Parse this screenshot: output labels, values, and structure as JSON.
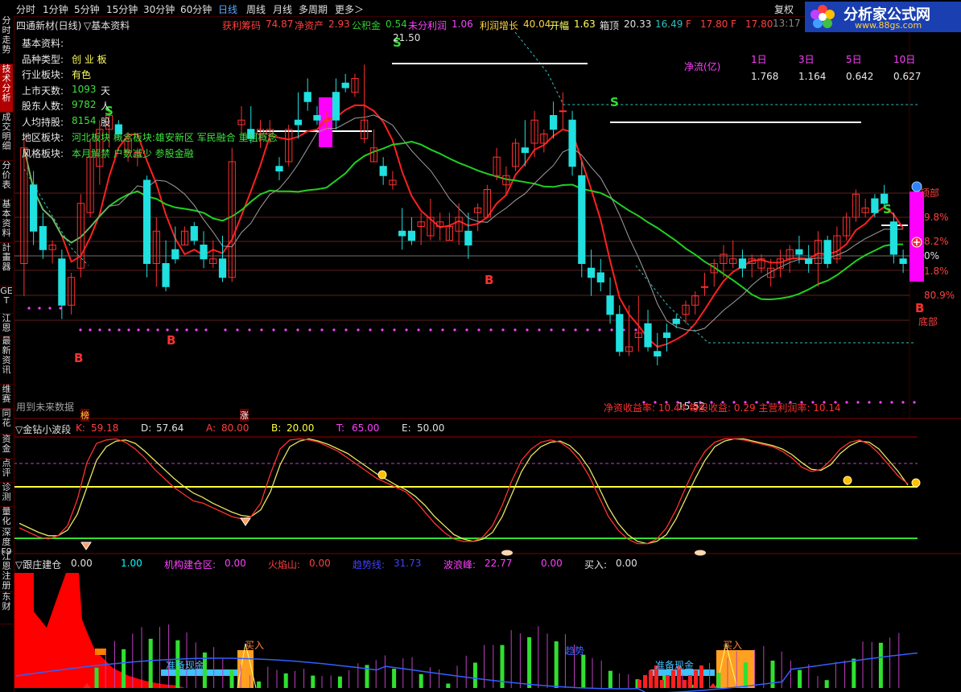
{
  "toolbar": {
    "timeframes": [
      "分时",
      "1分钟",
      "5分钟",
      "15分钟",
      "30分钟",
      "60分钟",
      "日线",
      "周线",
      "月线",
      "多周期",
      "更多＞"
    ],
    "active_index": 6,
    "fuquan": "复权",
    "time_fragment": "13:17"
  },
  "logo": {
    "title": "分析家公式网",
    "url": "www.88gs.com"
  },
  "sidebar": {
    "tabs": [
      "分时走势",
      "技术分析",
      "成交明细",
      "分价表",
      "基本资料",
      "計畫器",
      "GET",
      "江恩",
      "最新资讯",
      "维赛",
      "同花",
      "资金",
      "点评",
      "诊测",
      "量化",
      "深度F9",
      "江恩注册",
      "东财"
    ],
    "active_index": 1
  },
  "main_panel": {
    "title": "四通新材(日线)",
    "subtitle": "▽基本资料",
    "metrics": [
      {
        "label": "获利筹码",
        "value": "74.87"
      },
      {
        "label": "净资产",
        "value": "2.93"
      },
      {
        "label": "公积金",
        "value": "0.54"
      },
      {
        "label": "未分利润",
        "value": "1.06"
      },
      {
        "label": "利润增长",
        "value": "40.04"
      },
      {
        "label": "开幅",
        "value": "1.63"
      },
      {
        "label": "箱顶",
        "value": "20.33"
      },
      {
        "label": "",
        "value": "16.49"
      },
      {
        "label": "F",
        "value": "17.80"
      },
      {
        "label": "F",
        "value": "17.80"
      }
    ],
    "info_lines": [
      {
        "label": "基本资料:",
        "value": ""
      },
      {
        "label": "品种类型:",
        "value": "创 业 板"
      },
      {
        "label": "行业板块:",
        "value": "有色"
      },
      {
        "label": "上市天数:",
        "value": "1093",
        "unit": "天"
      },
      {
        "label": "股东人数:",
        "value": "9782",
        "unit": "人"
      },
      {
        "label": "人均持股:",
        "value": "8154",
        "unit": "股"
      },
      {
        "label": "地区板块:",
        "value": "河北板块 概念板块:雄安新区 军民融合 重组概念"
      },
      {
        "label": "风格板块:",
        "value": "本月解禁 户数减少 参股金融"
      }
    ],
    "net_flow": {
      "label": "净流(亿)",
      "headers": [
        "1日",
        "3日",
        "5日",
        "10日"
      ],
      "values": [
        "1.768",
        "1.164",
        "0.642",
        "0.627"
      ]
    },
    "price_high_label": "21.50",
    "price_low_label": "15.52",
    "footer_stats": "净资收益率: 10.44  每股收益: 0.29  主营利润率: 10.14",
    "future_data_note": "用到未来数据",
    "right_labels": [
      "顶部",
      "9.8%",
      "8.2%",
      "0%",
      "1.8%",
      "80.9%",
      "底部"
    ],
    "tags": [
      "榜",
      "涨"
    ],
    "signal_S": "S",
    "signal_B": "B"
  },
  "kd_panel": {
    "title": "▽金钻小波段",
    "items": [
      {
        "label": "K:",
        "value": "59.18",
        "color": "#ff4040"
      },
      {
        "label": "D:",
        "value": "57.64",
        "color": "#e0e0e0"
      },
      {
        "label": "A:",
        "value": "80.00",
        "color": "#ff4040"
      },
      {
        "label": "B:",
        "value": "20.00",
        "color": "#ffff40"
      },
      {
        "label": "T:",
        "value": "65.00",
        "color": "#ff40ff"
      },
      {
        "label": "E:",
        "value": "50.00",
        "color": "#e0e0e0"
      }
    ]
  },
  "vol_panel": {
    "title": "▽跟庄建仓",
    "items": [
      {
        "label": "",
        "value": "0.00",
        "color": "#e0e0e0"
      },
      {
        "label": "",
        "value": "1.00",
        "color": "#00ffff"
      },
      {
        "label": "机构建仓区:",
        "value": "0.00",
        "color": "#ff40ff"
      },
      {
        "label": "火焰山:",
        "value": "0.00",
        "color": "#ff4040"
      },
      {
        "label": "趋势线:",
        "value": "31.73",
        "color": "#4040ff"
      },
      {
        "label": "波浪峰:",
        "value": "22.77",
        "color": "#ff40ff"
      },
      {
        "label": "",
        "value": "0.00",
        "color": "#ff40ff"
      },
      {
        "label": "买入:",
        "value": "0.00",
        "color": "#e0e0e0"
      }
    ],
    "zone_labels": [
      "准备现金",
      "准备现金"
    ],
    "buy_labels": [
      "买入",
      "买入"
    ],
    "trend_label": "趋势"
  },
  "chart_data": [
    {
      "type": "candlestick",
      "title": "四通新材(日线)",
      "y_estimated_range": [
        14.5,
        22.5
      ],
      "candles": [
        [
          17.5,
          20.2,
          16.8,
          20.0
        ],
        [
          19.2,
          19.5,
          17.9,
          18.2
        ],
        [
          18.3,
          18.6,
          17.6,
          17.8
        ],
        [
          17.8,
          18.0,
          17.5,
          17.9
        ],
        [
          17.6,
          17.8,
          16.3,
          16.6
        ],
        [
          16.6,
          17.3,
          16.4,
          17.2
        ],
        [
          17.4,
          19.0,
          17.2,
          18.8
        ],
        [
          18.6,
          20.2,
          18.5,
          19.8
        ],
        [
          19.6,
          20.6,
          19.2,
          20.4
        ],
        [
          20.4,
          20.8,
          20.0,
          20.7
        ],
        [
          20.5,
          20.6,
          20.2,
          20.3
        ],
        [
          19.9,
          20.3,
          19.7,
          20.2
        ],
        [
          19.8,
          20.0,
          19.6,
          19.9
        ],
        [
          19.3,
          19.4,
          17.2,
          17.5
        ],
        [
          17.5,
          18.5,
          17.0,
          18.2
        ],
        [
          17.5,
          18.0,
          16.9,
          17.0
        ],
        [
          17.8,
          18.3,
          17.5,
          17.6
        ],
        [
          17.9,
          18.3,
          17.9,
          18.2
        ],
        [
          18.3,
          18.4,
          17.9,
          18.0
        ],
        [
          17.9,
          18.2,
          17.4,
          17.6
        ],
        [
          17.5,
          18.0,
          17.4,
          17.6
        ],
        [
          17.6,
          18.1,
          17.1,
          17.2
        ],
        [
          17.2,
          20.0,
          17.1,
          19.7
        ],
        [
          20.5,
          20.9,
          20.3,
          20.6
        ],
        [
          20.4,
          20.9,
          20.1,
          20.2
        ],
        [
          20.3,
          20.6,
          20.0,
          20.4
        ],
        [
          20.3,
          20.6,
          20.1,
          20.4
        ],
        [
          19.6,
          19.8,
          19.3,
          19.5
        ],
        [
          19.7,
          20.5,
          19.6,
          20.4
        ],
        [
          20.6,
          21.2,
          20.2,
          20.5
        ],
        [
          21.2,
          21.5,
          20.8,
          21.0
        ],
        [
          20.7,
          20.9,
          20.5,
          20.6
        ],
        [
          20.6,
          20.8,
          20.4,
          20.6
        ],
        [
          21.2,
          21.5,
          20.4,
          20.6
        ],
        [
          21.4,
          21.6,
          21.2,
          21.3
        ],
        [
          21.2,
          21.6,
          21.1,
          21.5
        ],
        [
          20.2,
          21.8,
          20.1,
          20.6
        ],
        [
          19.7,
          20.4,
          19.7,
          20.0
        ],
        [
          19.6,
          19.8,
          19.2,
          19.4
        ],
        [
          19.2,
          19.5,
          19.1,
          19.3
        ],
        [
          18.2,
          18.7,
          17.8,
          18.1
        ],
        [
          18.2,
          18.5,
          17.9,
          18.0
        ],
        [
          18.3,
          18.6,
          17.9,
          18.4
        ],
        [
          18.1,
          18.9,
          18.0,
          18.5
        ],
        [
          18.3,
          18.6,
          18.0,
          18.4
        ],
        [
          18.0,
          18.6,
          18.0,
          18.3
        ],
        [
          18.2,
          18.8,
          17.9,
          18.5
        ],
        [
          18.2,
          18.6,
          17.6,
          17.9
        ],
        [
          18.6,
          18.8,
          18.2,
          18.7
        ],
        [
          18.5,
          19.2,
          18.5,
          19.1
        ],
        [
          19.4,
          20.0,
          19.3,
          19.8
        ],
        [
          19.2,
          19.6,
          19.0,
          19.4
        ],
        [
          19.6,
          20.2,
          19.5,
          20.1
        ],
        [
          20.0,
          20.6,
          19.6,
          19.9
        ],
        [
          20.1,
          20.8,
          19.8,
          20.6
        ],
        [
          20.1,
          20.4,
          19.9,
          20.3
        ],
        [
          20.7,
          21.0,
          20.2,
          20.4
        ],
        [
          20.8,
          21.2,
          20.4,
          20.8
        ],
        [
          20.6,
          20.8,
          19.4,
          19.6
        ],
        [
          19.4,
          19.7,
          17.2,
          17.5
        ],
        [
          17.4,
          17.8,
          16.8,
          17.2
        ],
        [
          17.3,
          17.6,
          16.9,
          17.1
        ],
        [
          16.8,
          17.2,
          16.2,
          16.4
        ],
        [
          16.4,
          16.6,
          15.5,
          15.6
        ],
        [
          15.6,
          16.6,
          15.5,
          15.7
        ],
        [
          15.9,
          16.8,
          15.6,
          16.0
        ],
        [
          16.2,
          16.5,
          15.6,
          15.7
        ],
        [
          15.6,
          16.0,
          15.3,
          15.5
        ],
        [
          16.0,
          16.2,
          15.6,
          15.9
        ],
        [
          16.3,
          16.4,
          16.1,
          16.2
        ],
        [
          16.4,
          16.7,
          16.2,
          16.6
        ],
        [
          16.6,
          16.9,
          16.4,
          16.8
        ],
        [
          17.0,
          17.3,
          16.8,
          17.0
        ],
        [
          17.3,
          17.6,
          17.0,
          17.5
        ],
        [
          17.5,
          17.9,
          17.2,
          17.7
        ],
        [
          17.5,
          18.0,
          17.4,
          17.6
        ],
        [
          17.6,
          17.8,
          17.2,
          17.4
        ],
        [
          17.5,
          17.7,
          17.2,
          17.6
        ],
        [
          17.4,
          17.7,
          17.3,
          17.6
        ],
        [
          17.2,
          17.6,
          17.0,
          17.4
        ],
        [
          17.4,
          17.8,
          17.2,
          17.6
        ],
        [
          17.6,
          17.9,
          17.3,
          17.8
        ],
        [
          17.8,
          18.1,
          17.5,
          17.7
        ],
        [
          17.6,
          17.9,
          17.3,
          17.5
        ],
        [
          17.5,
          18.2,
          17.0,
          18.0
        ],
        [
          18.0,
          18.1,
          17.4,
          17.5
        ],
        [
          17.6,
          18.3,
          17.5,
          18.1
        ],
        [
          18.1,
          18.6,
          18.0,
          18.5
        ],
        [
          18.5,
          19.1,
          18.4,
          19.0
        ],
        [
          18.6,
          18.9,
          18.5,
          18.7
        ],
        [
          18.9,
          19.0,
          18.5,
          18.6
        ],
        [
          19.0,
          19.2,
          18.7,
          18.8
        ],
        [
          18.4,
          18.6,
          17.5,
          17.7
        ],
        [
          17.6,
          17.8,
          17.3,
          17.5
        ]
      ],
      "ma_lines": [
        {
          "name": "",
          "color": "#ff2020"
        },
        {
          "name": "",
          "color": "#20d020"
        },
        {
          "name": "",
          "color": "#a0a0a0"
        }
      ]
    },
    {
      "type": "line",
      "title": "▽金钻小波段",
      "y_range": [
        0,
        100
      ],
      "series": [
        {
          "name": "K",
          "values": [
            20,
            16,
            12,
            10,
            13,
            22,
            45,
            78,
            95,
            98,
            99,
            96,
            90,
            82,
            72,
            64,
            56,
            50,
            44,
            42,
            38,
            34,
            30,
            28,
            30,
            42,
            68,
            90,
            98,
            99,
            98,
            96,
            92,
            88,
            82,
            76,
            70,
            64,
            60,
            56,
            52,
            44,
            34,
            24,
            16,
            10,
            8,
            8,
            12,
            22,
            40,
            62,
            80,
            90,
            96,
            98,
            96,
            90,
            80,
            66,
            48,
            30,
            18,
            10,
            6,
            6,
            10,
            20,
            36,
            56,
            74,
            88,
            96,
            99,
            99,
            98,
            96,
            94,
            92,
            88,
            82,
            74,
            70,
            72,
            80,
            90,
            96,
            98,
            94,
            86,
            76,
            66,
            59
          ]
        },
        {
          "name": "D",
          "values": [
            24,
            20,
            16,
            13,
            13,
            18,
            32,
            56,
            80,
            92,
            97,
            98,
            95,
            88,
            80,
            72,
            64,
            57,
            51,
            47,
            42,
            38,
            34,
            31,
            30,
            36,
            52,
            76,
            92,
            97,
            99,
            97,
            94,
            90,
            86,
            80,
            74,
            68,
            63,
            58,
            54,
            48,
            40,
            30,
            22,
            14,
            10,
            8,
            10,
            16,
            30,
            50,
            70,
            84,
            92,
            96,
            97,
            93,
            85,
            73,
            56,
            38,
            24,
            14,
            8,
            6,
            8,
            14,
            28,
            46,
            64,
            80,
            92,
            97,
            99,
            99,
            97,
            95,
            93,
            90,
            85,
            78,
            72,
            71,
            76,
            86,
            93,
            97,
            96,
            90,
            80,
            70,
            58
          ]
        },
        {
          "name": "A",
          "values": [
            80
          ]
        },
        {
          "name": "B",
          "values": [
            20
          ]
        },
        {
          "name": "T",
          "values": [
            65
          ]
        },
        {
          "name": "E",
          "values": [
            50
          ]
        }
      ]
    },
    {
      "type": "bar",
      "title": "▽跟庄建仓",
      "series": [
        {
          "name": "趋势线",
          "values": []
        },
        {
          "name": "波浪峰",
          "values": []
        }
      ]
    }
  ]
}
